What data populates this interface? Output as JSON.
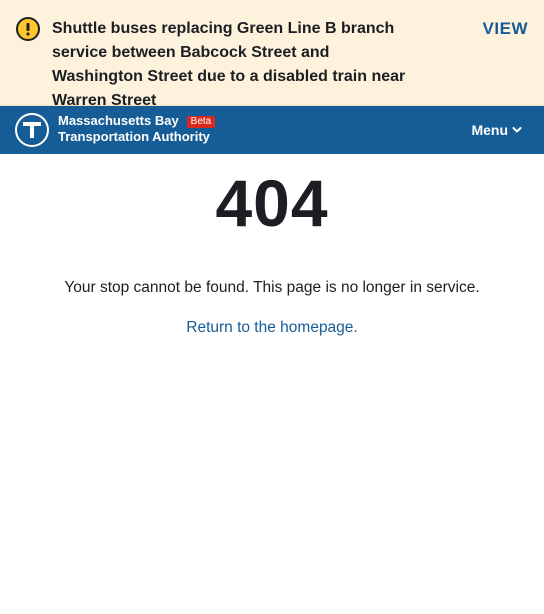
{
  "alert": {
    "icon": "warning-icon",
    "text": "Shuttle buses replacing Green Line B branch service between Babcock Street and Washington Street due to a disabled train near Warren Street",
    "action_label": "VIEW",
    "background": "#fdf3dd",
    "icon_color": "#ffc72c"
  },
  "header": {
    "logo_icon": "mbta-t-logo-icon",
    "brand_line1": "Massachusetts Bay",
    "brand_line2": "Transportation Authority",
    "beta_label": "Beta",
    "menu_label": "Menu",
    "menu_icon": "chevron-down-icon",
    "background": "#165c96",
    "beta_color": "#da291c"
  },
  "main": {
    "error_code": "404",
    "message": "Your stop cannot be found. This page is no longer in service.",
    "home_link_label": "Return to the homepage.",
    "link_color": "#165c96"
  }
}
